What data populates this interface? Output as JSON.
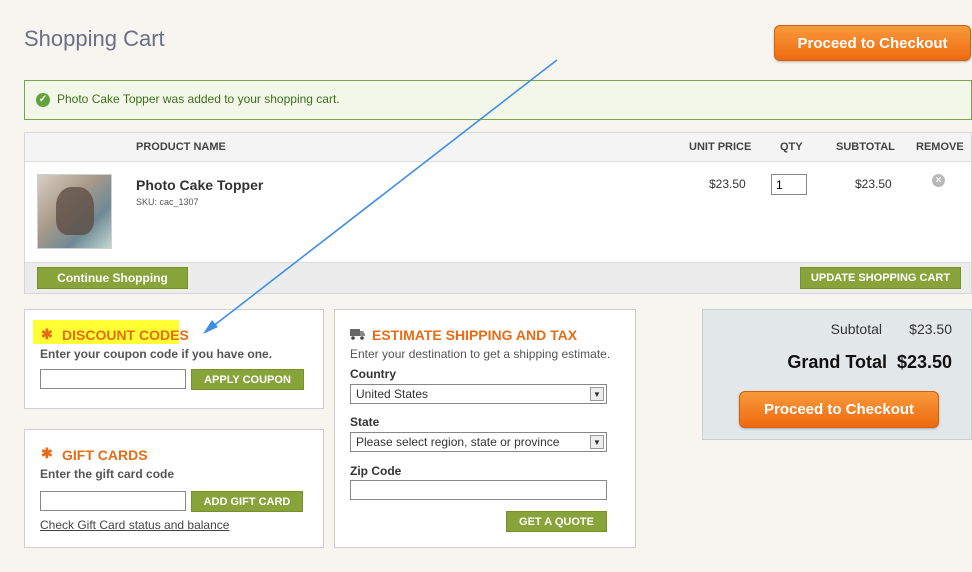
{
  "page": {
    "title": "Shopping Cart",
    "checkout_label": "Proceed to Checkout"
  },
  "message": {
    "text": "Photo Cake Topper was added to your shopping cart."
  },
  "cart": {
    "headers": {
      "product": "PRODUCT NAME",
      "unit_price": "UNIT PRICE",
      "qty": "QTY",
      "subtotal": "SUBTOTAL",
      "remove": "REMOVE"
    },
    "item": {
      "name": "Photo Cake Topper",
      "sku": "SKU: cac_1307",
      "unit_price": "$23.50",
      "qty": "1",
      "subtotal": "$23.50"
    },
    "continue_label": "Continue Shopping",
    "update_label": "UPDATE SHOPPING CART"
  },
  "discount": {
    "title": "DISCOUNT CODES",
    "subtitle": "Enter your coupon code if you have one.",
    "button": "APPLY COUPON",
    "value": ""
  },
  "gift": {
    "title": "GIFT CARDS",
    "subtitle": "Enter the gift card code",
    "button": "ADD GIFT CARD",
    "link": "Check Gift Card status and balance",
    "value": ""
  },
  "shipping": {
    "title": "ESTIMATE SHIPPING AND TAX",
    "subtitle": "Enter your destination to get a shipping estimate.",
    "country_label": "Country",
    "country_value": "United States",
    "state_label": "State",
    "state_value": "Please select region, state or province",
    "zip_label": "Zip Code",
    "zip_value": "",
    "button": "GET A QUOTE"
  },
  "totals": {
    "subtotal_label": "Subtotal",
    "subtotal_value": "$23.50",
    "grand_label": "Grand Total",
    "grand_value": "$23.50"
  },
  "colors": {
    "accent_orange": "#ef6a10",
    "green": "#88a33a",
    "highlight": "#ffff33",
    "annotation_arrow": "#3d8fe6"
  }
}
